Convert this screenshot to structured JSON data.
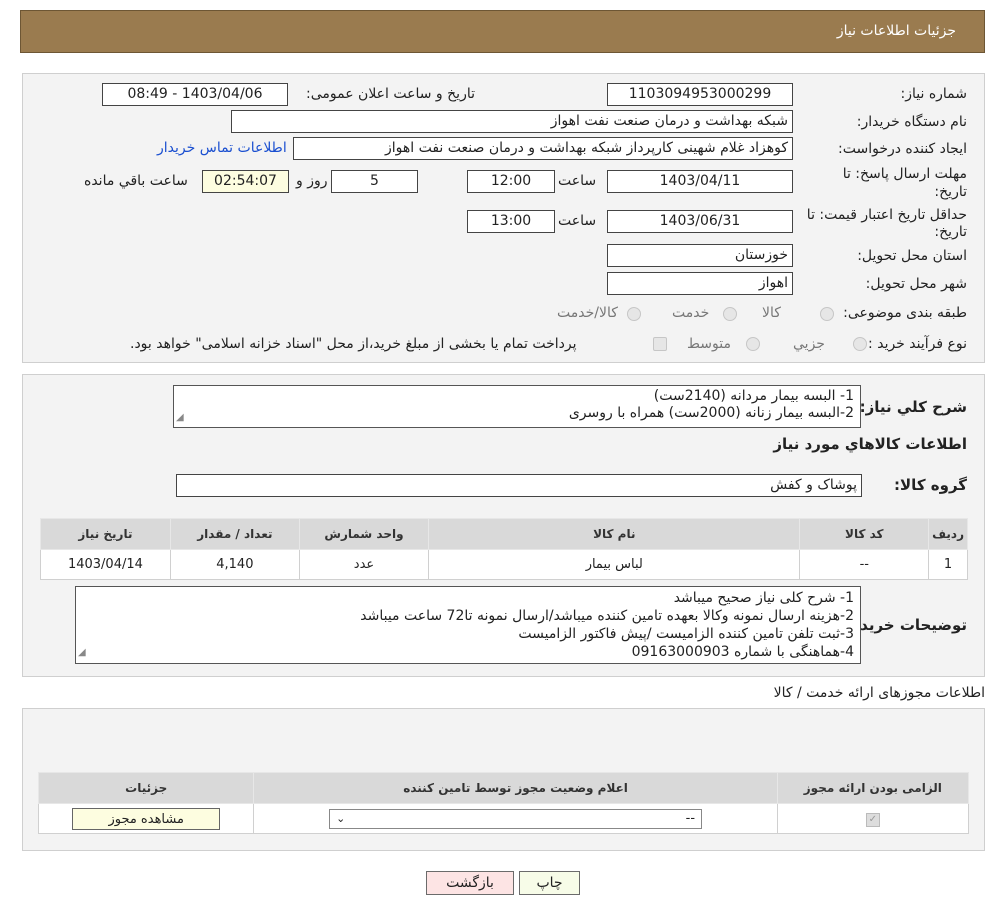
{
  "header": {
    "title": "جزئیات اطلاعات نیاز"
  },
  "form": {
    "need_number_label": "شماره نیاز:",
    "need_number": "1103094953000299",
    "announce_label": "تاریخ و ساعت اعلان عمومی:",
    "announce_value": "1403/04/06 - 08:49",
    "buyer_org_label": "نام دستگاه خریدار:",
    "buyer_org": "شبکه بهداشت و درمان صنعت نفت اهواز",
    "creator_label": "ایجاد کننده درخواست:",
    "creator": "کوهزاد غلام شهینی کارپرداز شبکه بهداشت و درمان صنعت نفت اهواز",
    "contact_link": "اطلاعات تماس خریدار",
    "deadline_label_1": "مهلت ارسال پاسخ: تا",
    "deadline_label_2": "تاریخ:",
    "deadline_date": "1403/04/11",
    "time_label": "ساعت",
    "deadline_time": "12:00",
    "days_value": "5",
    "days_label": "روز و",
    "remaining_time": "02:54:07",
    "remaining_label": "ساعت باقي مانده",
    "validity_label_1": "حداقل تاریخ اعتبار قیمت: تا",
    "validity_label_2": "تاریخ:",
    "validity_date": "1403/06/31",
    "validity_time": "13:00",
    "province_label": "استان محل تحویل:",
    "province": "خوزستان",
    "city_label": "شهر محل تحویل:",
    "city": "اهواز",
    "category_label": "طبقه بندی موضوعی:",
    "category_options": [
      "کالا",
      "خدمت",
      "کالا/خدمت"
    ],
    "purchase_label": "نوع فرآیند خرید :",
    "purchase_options": [
      "جزیي",
      "متوسط"
    ],
    "purchase_note": "پرداخت تمام یا بخشی از مبلغ خرید،از محل \"اسناد خزانه اسلامی\" خواهد بود."
  },
  "summary": {
    "label": "شرح کلي نياز:",
    "lines": [
      "1- البسه بیمار مردانه (2140ست)",
      "2-البسه بیمار زنانه (2000ست) همراه با روسری"
    ],
    "goods_info_title": "اطلاعات کالاهاي مورد نياز",
    "group_label": "گروه کالا:",
    "group_value": "پوشاک و کفش"
  },
  "goods_table": {
    "headers": [
      "رديف",
      "کد کالا",
      "نام کالا",
      "واحد شمارش",
      "تعداد / مقدار",
      "تاريخ نياز"
    ],
    "rows": [
      [
        "1",
        "--",
        "لباس بیمار",
        "عدد",
        "4,140",
        "1403/04/14"
      ]
    ]
  },
  "buyer_notes": {
    "label": "توضیحات خریدار:",
    "lines": [
      "1- شرح کلی نیاز صحیح میباشد",
      "2-هزینه ارسال نمونه وکالا بعهده تامین کننده میباشد/ارسال نمونه تا72 ساعت میباشد",
      "3-ثبت تلفن تامین کننده الزامیست /پیش فاکتور الزامیست",
      "4-هماهنگی با شماره 09163000903"
    ]
  },
  "permits": {
    "title": "اطلاعات مجوزهای ارائه خدمت / کالا",
    "headers": [
      "الزامی بودن ارائه مجوز",
      "اعلام وضعیت مجوز توسط تامین کننده",
      "جزئیات"
    ],
    "select_value": "--",
    "view_button": "مشاهده مجوز"
  },
  "buttons": {
    "print": "چاپ",
    "back": "بازگشت"
  }
}
